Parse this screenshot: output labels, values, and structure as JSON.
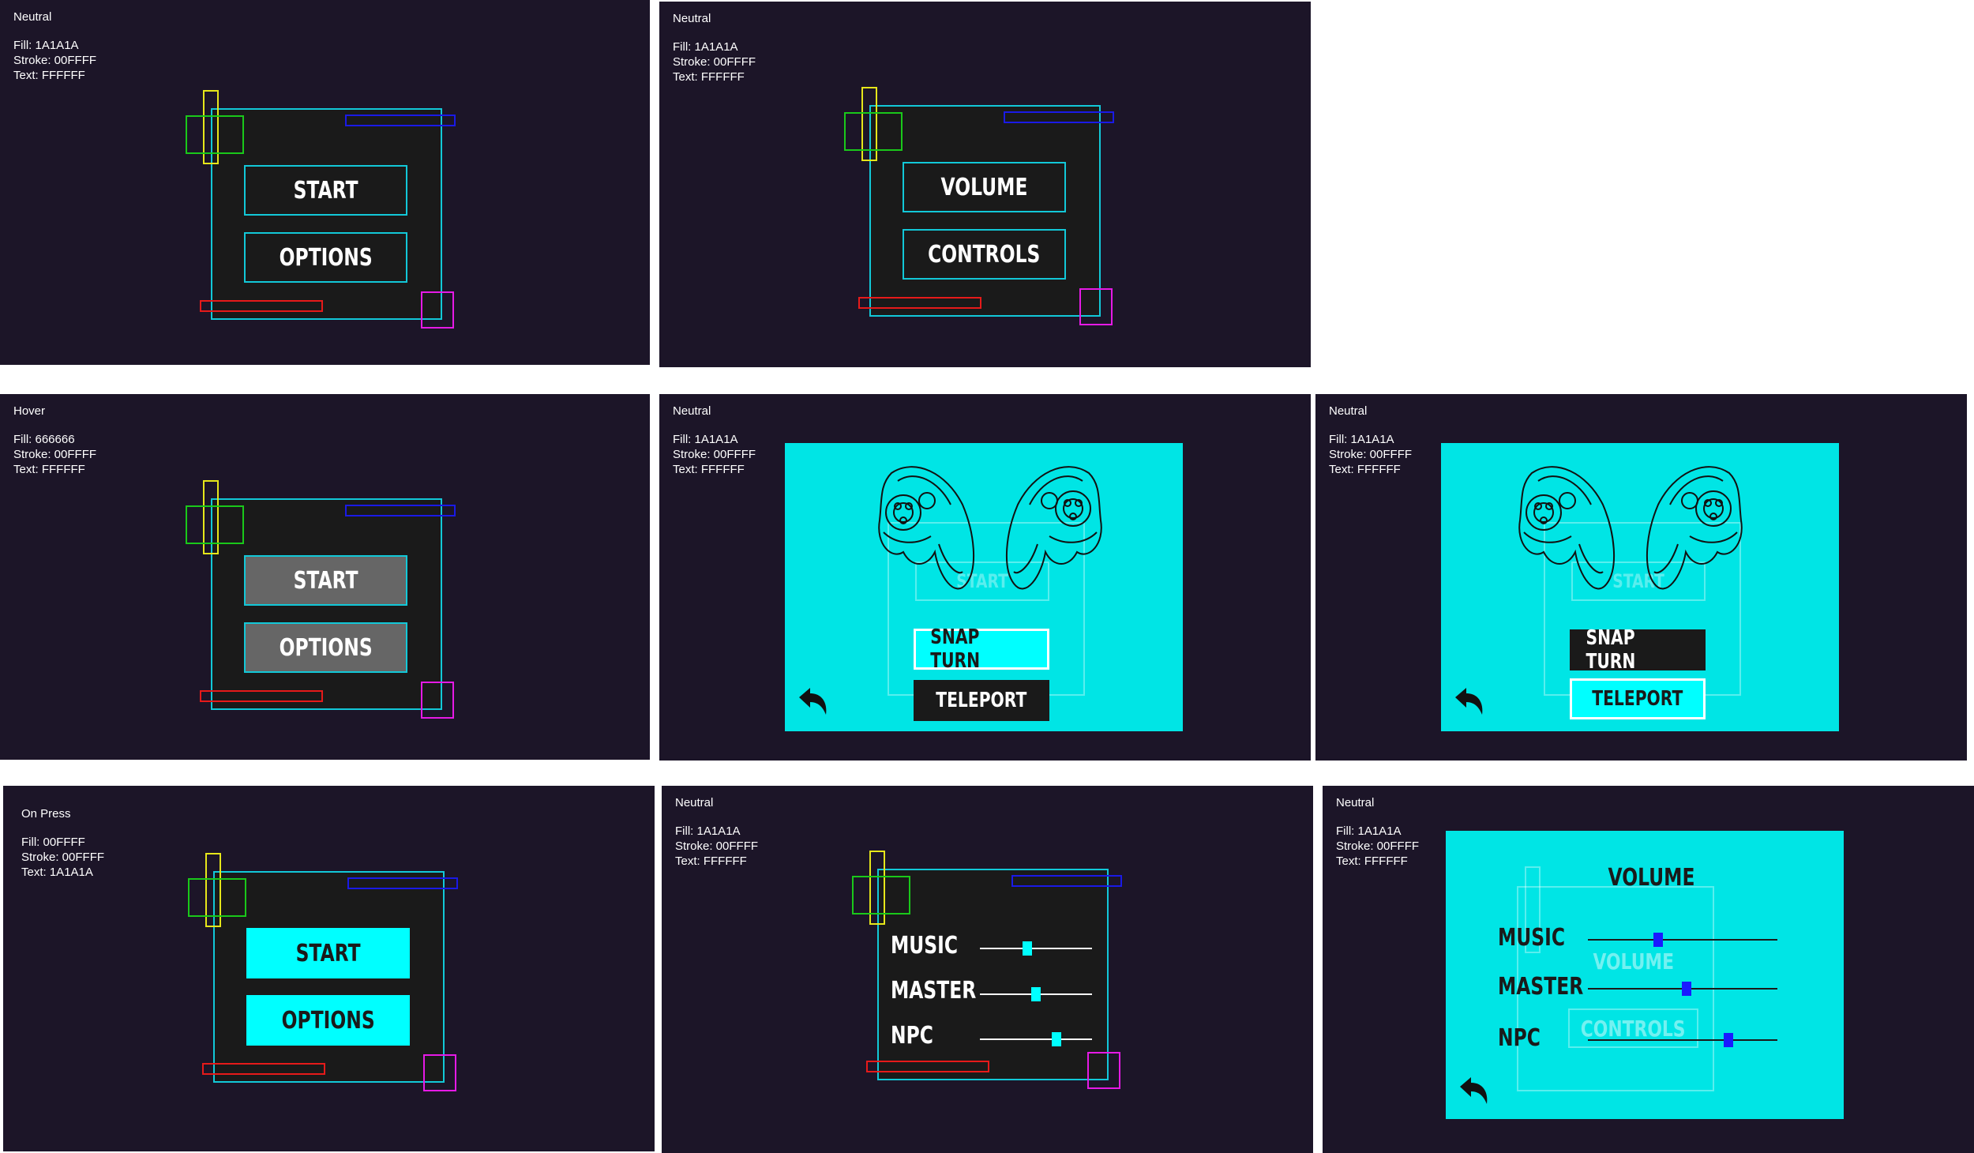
{
  "colors": {
    "panel_bg": "#1c1528",
    "menu_fill": "#1a1a1a",
    "stroke": "#00ffff",
    "hover_fill": "#666666",
    "press_fill": "#00ffff",
    "text_light": "#ffffff",
    "text_dark": "#1a1a1a",
    "cyan_panel": "#00e5e5",
    "slider_knob_blue": "#1a1aff"
  },
  "panels": {
    "main_neutral": {
      "state": "Neutral",
      "fill": "Fill: 1A1A1A",
      "stroke": "Stroke: 00FFFF",
      "text": "Text: FFFFFF",
      "buttons": [
        "START",
        "OPTIONS"
      ]
    },
    "options_neutral": {
      "state": "Neutral",
      "fill": "Fill: 1A1A1A",
      "stroke": "Stroke: 00FFFF",
      "text": "Text: FFFFFF",
      "buttons": [
        "VOLUME",
        "CONTROLS"
      ]
    },
    "main_hover": {
      "state": "Hover",
      "fill": "Fill: 666666",
      "stroke": "Stroke:  00FFFF",
      "text": "Text: FFFFFF",
      "buttons": [
        "START",
        "OPTIONS"
      ]
    },
    "controls_snap": {
      "state": "Neutral",
      "fill": "Fill: 1A1A1A",
      "stroke": "Stroke: 00FFFF",
      "text": "Text: FFFFFF",
      "ghost": "START",
      "buttons": [
        "SNAP TURN",
        "TELEPORT"
      ]
    },
    "controls_teleport": {
      "state": "Neutral",
      "fill": "Fill: 1A1A1A",
      "stroke": "Stroke: 00FFFF",
      "text": "Text: FFFFFF",
      "ghost": "START",
      "buttons": [
        "SNAP TURN",
        "TELEPORT"
      ]
    },
    "main_press": {
      "state": "On Press",
      "fill": "Fill: 00FFFF",
      "stroke": "Stroke: 00FFFF",
      "text": "Text: 1A1A1A",
      "buttons": [
        "START",
        "OPTIONS"
      ]
    },
    "volume_neutral": {
      "state": "Neutral",
      "fill": "Fill: 1A1A1A",
      "stroke": "Stroke: 00FFFF",
      "text": "Text: FFFFFF",
      "sliders": [
        {
          "label": "MUSIC",
          "level": 0.42
        },
        {
          "label": "MASTER",
          "level": 0.5
        },
        {
          "label": "NPC",
          "level": 0.68
        }
      ]
    },
    "volume_cyan": {
      "state": "Neutral",
      "fill": "Fill: 1A1A1A",
      "stroke": "Stroke: 00FFFF",
      "text": "Text: FFFFFF",
      "title": "VOLUME",
      "ghost_top": "VOLUME",
      "ghost_bottom": "CONTROLS",
      "sliders": [
        {
          "label": "MUSIC",
          "level": 0.37
        },
        {
          "label": "MASTER",
          "level": 0.52
        },
        {
          "label": "NPC",
          "level": 0.74
        }
      ]
    }
  },
  "icons": {
    "back": "back-arrow-icon",
    "controllers": "vr-controllers-icon"
  }
}
